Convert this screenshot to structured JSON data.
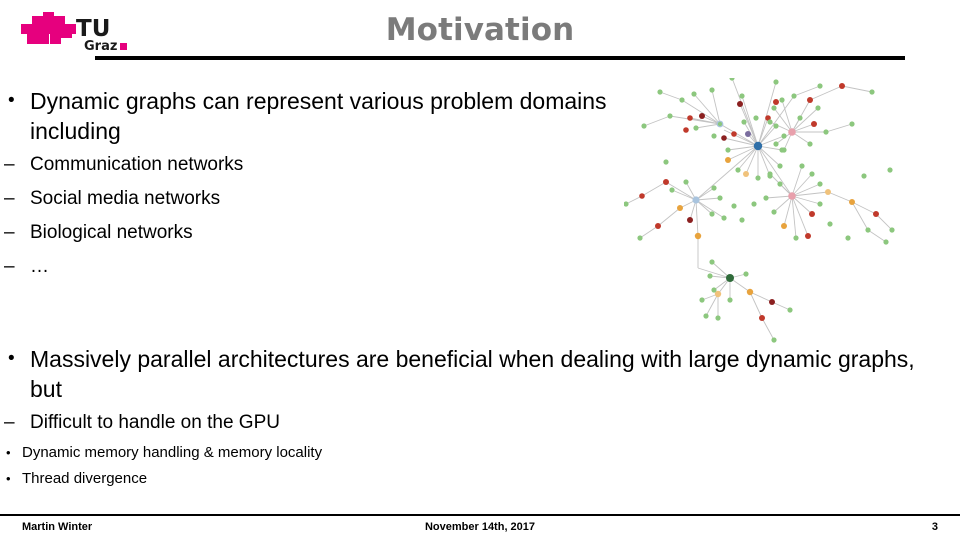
{
  "slide": {
    "title": "Motivation",
    "title_color": "#7b7b7b",
    "background": "#ffffff"
  },
  "logo": {
    "name": "TU Graz",
    "line1": "TU",
    "line2": "Graz",
    "mark_color": "#e6007e",
    "text_color": "#1a1a1a"
  },
  "content": {
    "bullet1": {
      "marker": "•",
      "text": "Dynamic graphs can represent various problem domains including",
      "subitems": [
        {
          "marker": "–",
          "text": "Communication networks"
        },
        {
          "marker": "–",
          "text": "Social media networks"
        },
        {
          "marker": "–",
          "text": "Biological networks"
        },
        {
          "marker": "–",
          "text": "…"
        }
      ]
    },
    "bullet2": {
      "marker": "•",
      "text": "Massively parallel architectures are beneficial when dealing with large dynamic graphs, but",
      "subitem": {
        "marker": "–",
        "text": "Difficult to handle on the GPU"
      },
      "subsubitems": [
        {
          "marker": "•",
          "text": "Dynamic memory handling & memory locality"
        },
        {
          "marker": "•",
          "text": "Thread divergence"
        }
      ]
    }
  },
  "figure": {
    "name": "dynamic-graph-network-diagram",
    "node_colors": {
      "green": "#8cc77e",
      "red": "#c0392b",
      "dark_red": "#8b2020",
      "orange": "#e8a33d",
      "light_orange": "#f0c27b",
      "blue": "#2f6fa8",
      "light_blue": "#a9c4de",
      "pink": "#e8a0ac",
      "purple": "#7a6d9e",
      "dark_green": "#2f6b3a"
    },
    "edge_color": "#c3c3c3"
  },
  "footer": {
    "author": "Martin Winter",
    "date": "November 14th, 2017",
    "page": "3"
  }
}
